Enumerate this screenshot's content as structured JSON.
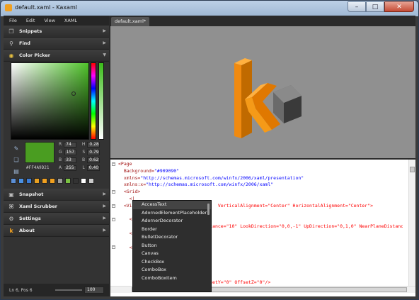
{
  "window": {
    "title": "default.xaml - Kaxaml",
    "controls": [
      "–",
      "□",
      "✕"
    ]
  },
  "menu": [
    "File",
    "Edit",
    "View",
    "XAML"
  ],
  "panels": {
    "snippets": "Snippets",
    "find": "Find",
    "color_picker": "Color Picker",
    "snapshot": "Snapshot",
    "xaml_scrubber": "Xaml Scrubber",
    "settings": "Settings",
    "about": "About"
  },
  "color": {
    "hex": "#FF4A9D21",
    "R": "74",
    "G": "157",
    "B": "33",
    "A": "255",
    "H": "0.28",
    "S": "0.79",
    "Bv": "0.62",
    "L": "0.40",
    "selected": "#4a9d21",
    "palette": [
      "#5b8fd6",
      "#4a90e2",
      "#3a7bd5",
      "#e8a020",
      "#f0a020",
      "#f0a020",
      "#9a9a9a",
      "#7ac142",
      "#333333",
      "#ffffff",
      "#cccccc"
    ]
  },
  "status": {
    "position": "Ln 6, Pos 6",
    "zoom": "100"
  },
  "tab": {
    "label": "default.xaml*"
  },
  "code_lines": [
    [
      "<Page",
      "",
      "",
      "",
      ""
    ],
    [
      "  Background=",
      "\"#909090\"",
      "",
      "",
      ""
    ],
    [
      "  xmlns=",
      "\"http://schemas.microsoft.com/winfx/2006/xaml/presentation\"",
      "",
      "",
      ""
    ],
    [
      "  xmlns:x=",
      "\"http://schemas.microsoft.com/winfx/2006/xaml\"",
      "",
      "",
      ""
    ],
    [
      "  <Grid>",
      "",
      "",
      "",
      ""
    ],
    [
      "    <|",
      "",
      "",
      "",
      ""
    ],
    [
      "  <Vi",
      "",
      "                         600\"  VerticalAlignment=\"Center\" HorizontalAlignment=\"Center\">",
      "",
      ""
    ],
    [
      "",
      "",
      "",
      "",
      ""
    ],
    [
      "    <Vi",
      "",
      "",
      "",
      ""
    ],
    [
      "      <",
      "",
      "                          tance=\"10\" LookDirection=\"0,0,-1\" UpDirection=\"0,1,0\" NearPlaneDistance=",
      "",
      ""
    ],
    [
      "    </V",
      "",
      "",
      "",
      ""
    ],
    [
      "",
      "",
      "",
      "",
      ""
    ],
    [
      "    <Mo",
      "",
      "",
      "",
      ""
    ],
    [
      "",
      "",
      "",
      "",
      ""
    ],
    [
      "",
      "",
      "",
      "",
      ""
    ],
    [
      "",
      "",
      "",
      "",
      ""
    ],
    [
      "",
      "",
      "",
      "",
      ""
    ],
    [
      "",
      "",
      "                  OffsetX=\"0\" OffsetY=\"0\" OffsetZ=\"0\"/>",
      "",
      ""
    ]
  ],
  "autocomplete": [
    "AccessText",
    "AdornedElementPlaceholder",
    "AdornerDecorator",
    "Border",
    "BulletDecorator",
    "Button",
    "Canvas",
    "CheckBox",
    "ComboBox",
    "ComboBoxItem"
  ]
}
